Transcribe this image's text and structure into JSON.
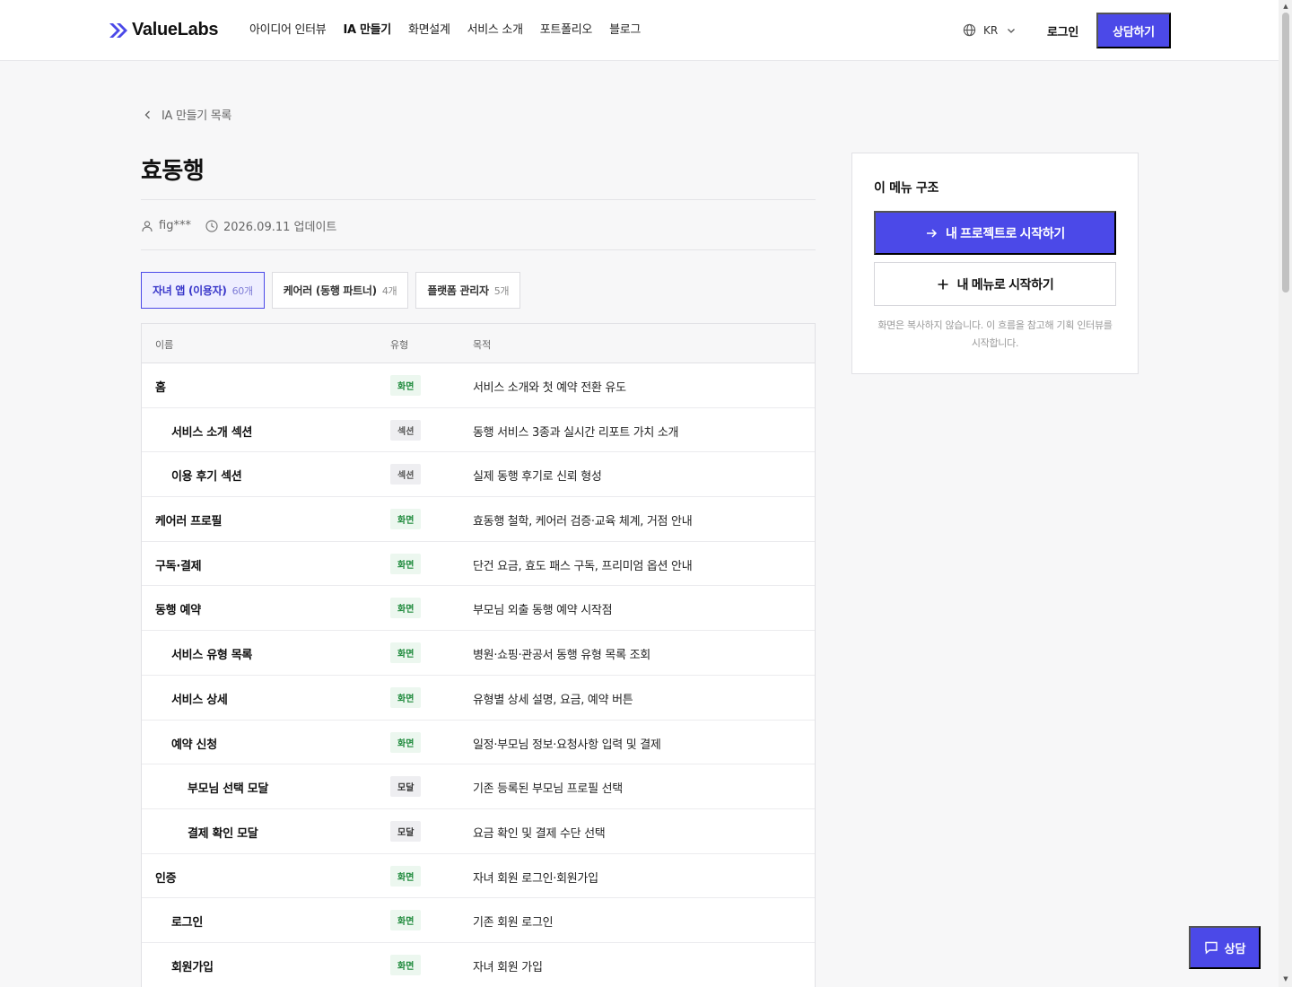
{
  "header": {
    "logo": "ValueLabs",
    "nav": [
      "아이디어 인터뷰",
      "IA 만들기",
      "화면설계",
      "서비스 소개",
      "포트폴리오",
      "블로그"
    ],
    "active_nav": "IA 만들기",
    "lang": "KR",
    "login": "로그인",
    "consult": "상담하기"
  },
  "back_link": "IA 만들기 목록",
  "page_title": "효동행",
  "meta": {
    "author": "fig***",
    "updated": "2026.09.11 업데이트"
  },
  "tabs": [
    {
      "label": "자녀 앱 (이용자)",
      "count": "60개",
      "active": true
    },
    {
      "label": "케어러 (동행 파트너)",
      "count": "4개",
      "active": false
    },
    {
      "label": "플랫폼 관리자",
      "count": "5개",
      "active": false
    }
  ],
  "table": {
    "headers": {
      "name": "이름",
      "type": "유형",
      "purpose": "목적"
    },
    "rows": [
      {
        "name": "홈",
        "depth": 0,
        "type": "화면",
        "kind": "screen",
        "purpose": "서비스 소개와 첫 예약 전환 유도"
      },
      {
        "name": "서비스 소개 섹션",
        "depth": 1,
        "type": "섹션",
        "kind": "section",
        "purpose": "동행 서비스 3종과 실시간 리포트 가치 소개"
      },
      {
        "name": "이용 후기 섹션",
        "depth": 1,
        "type": "섹션",
        "kind": "section",
        "purpose": "실제 동행 후기로 신뢰 형성"
      },
      {
        "name": "케어러 프로필",
        "depth": 0,
        "type": "화면",
        "kind": "screen",
        "purpose": "효동행 철학, 케어러 검증·교육 체계, 거점 안내"
      },
      {
        "name": "구독·결제",
        "depth": 0,
        "type": "화면",
        "kind": "screen",
        "purpose": "단건 요금, 효도 패스 구독, 프리미엄 옵션 안내"
      },
      {
        "name": "동행 예약",
        "depth": 0,
        "type": "화면",
        "kind": "screen",
        "purpose": "부모님 외출 동행 예약 시작점"
      },
      {
        "name": "서비스 유형 목록",
        "depth": 1,
        "type": "화면",
        "kind": "screen",
        "purpose": "병원·쇼핑·관공서 동행 유형 목록 조회"
      },
      {
        "name": "서비스 상세",
        "depth": 1,
        "type": "화면",
        "kind": "screen",
        "purpose": "유형별 상세 설명, 요금, 예약 버튼"
      },
      {
        "name": "예약 신청",
        "depth": 1,
        "type": "화면",
        "kind": "screen",
        "purpose": "일정·부모님 정보·요청사항 입력 및 결제"
      },
      {
        "name": "부모님 선택 모달",
        "depth": 2,
        "type": "모달",
        "kind": "modal",
        "purpose": "기존 등록된 부모님 프로필 선택"
      },
      {
        "name": "결제 확인 모달",
        "depth": 2,
        "type": "모달",
        "kind": "modal",
        "purpose": "요금 확인 및 결제 수단 선택"
      },
      {
        "name": "인증",
        "depth": 0,
        "type": "화면",
        "kind": "screen",
        "purpose": "자녀 회원 로그인·회원가입"
      },
      {
        "name": "로그인",
        "depth": 1,
        "type": "화면",
        "kind": "screen",
        "purpose": "기존 회원 로그인"
      },
      {
        "name": "회원가입",
        "depth": 1,
        "type": "화면",
        "kind": "screen",
        "purpose": "자녀 회원 가입"
      }
    ]
  },
  "side": {
    "title": "이 메뉴 구조",
    "primary": "내 프로젝트로 시작하기",
    "secondary": "내 메뉴로 시작하기",
    "note": "화면은 복사하지 않습니다. 이 흐름을 참고해 기획 인터뷰를 시작합니다."
  },
  "float_chat": "상담",
  "colors": {
    "accent": "#4b49e8",
    "screen_badge": "#1f8a3c"
  }
}
